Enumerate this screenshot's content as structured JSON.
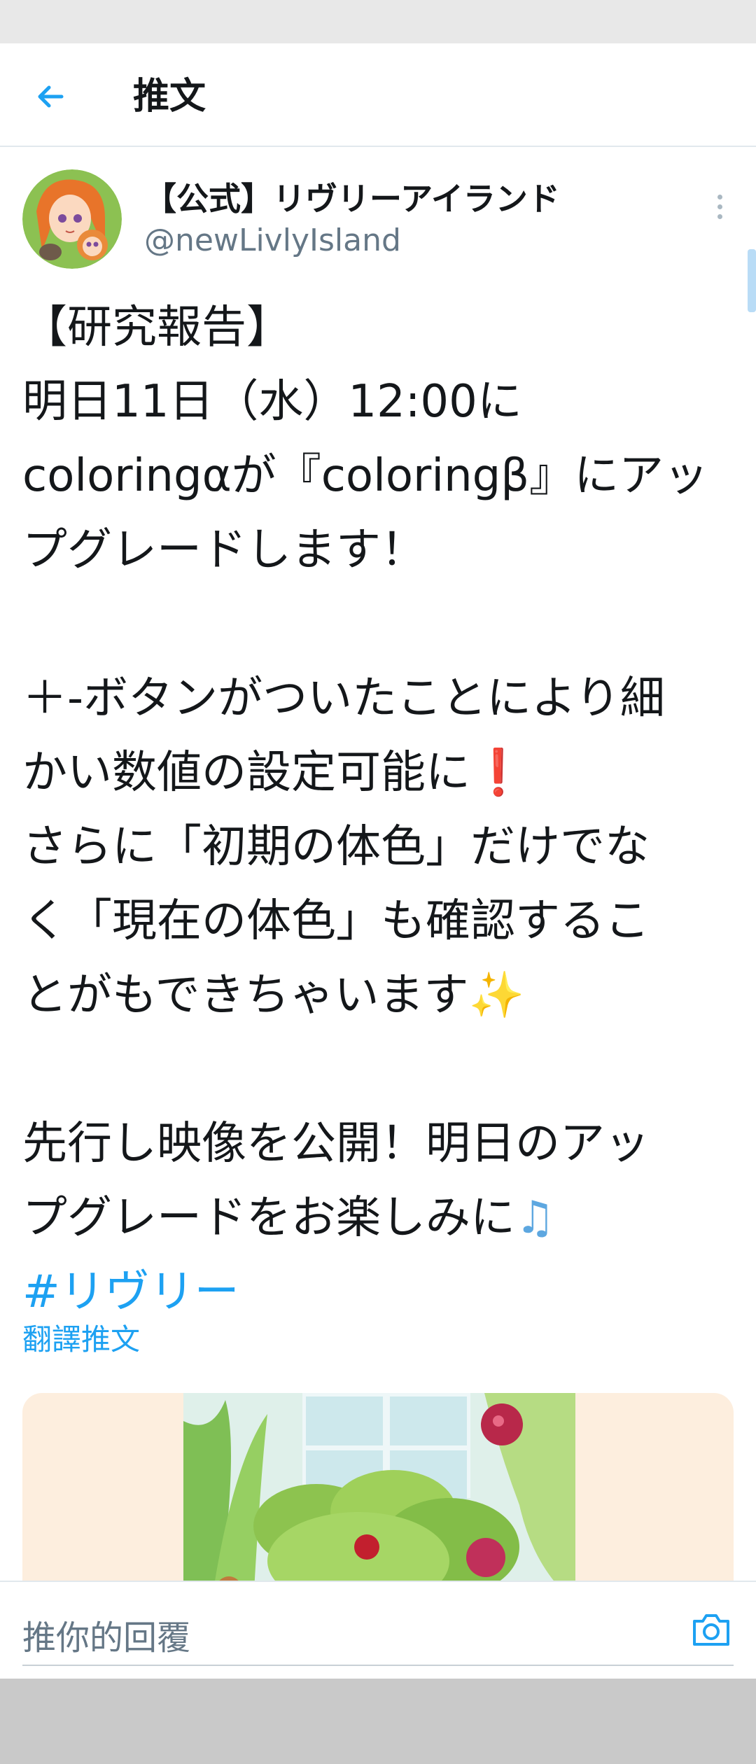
{
  "header": {
    "title": "推文"
  },
  "tweet": {
    "display_name": "【公式】リヴリーアイランド",
    "handle": "@newLivlyIsland",
    "lines": [
      "【研究報告】",
      "明日11日（水）12:00に",
      "coloringαが『coloringβ』にアッ",
      "プグレードします！",
      "",
      "＋-ボタンがついたことにより細",
      "かい数値の設定可能に",
      "さらに「初期の体色」だけでな",
      "く「現在の体色」も確認するこ",
      "とがもできちゃいます",
      "",
      "先行し映像を公開！明日のアッ",
      "プグレードをお楽しみに"
    ],
    "hashtag": "#リヴリー",
    "emoji": {
      "exclamation": "❗",
      "sparkles": "✨",
      "notes": "♫"
    },
    "translate_label": "翻譯推文",
    "icons": {
      "back": "back-arrow-icon",
      "more": "more-vertical-icon",
      "camera": "camera-icon"
    }
  },
  "reply": {
    "placeholder": "推你的回覆"
  },
  "colors": {
    "accent": "#1da1f2",
    "text": "#14171a",
    "secondary": "#657786",
    "media_bg": "#fdeede"
  }
}
